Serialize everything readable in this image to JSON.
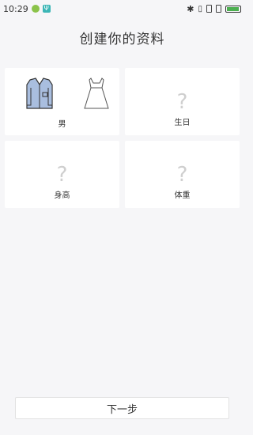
{
  "status_bar": {
    "time": "10:29",
    "icons": [
      "app-icon",
      "usb-icon",
      "bluetooth-icon",
      "vibrate-icon",
      "sim-icon",
      "sim-icon",
      "battery-icon"
    ],
    "battery_percent": 0.95,
    "battery_color": "#4caf50"
  },
  "title": "创建你的资料",
  "cards": {
    "gender": {
      "label": "男",
      "options": [
        "male-shirt-icon",
        "female-dress-icon"
      ],
      "selected": "male"
    },
    "birthday": {
      "label": "生日",
      "placeholder": "?"
    },
    "height": {
      "label": "身高",
      "placeholder": "?"
    },
    "weight": {
      "label": "体重",
      "placeholder": "?"
    }
  },
  "next_button": {
    "label": "下一步"
  },
  "colors": {
    "background": "#f6f6f8",
    "shirt_fill": "#a9bedf",
    "placeholder": "#cfcfcf"
  }
}
